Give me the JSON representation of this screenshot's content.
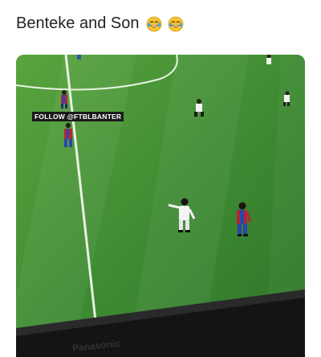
{
  "post": {
    "caption": "Benteke and Son",
    "emoji": [
      "face-with-tears-of-joy-icon",
      "face-with-tears-of-joy-icon"
    ]
  },
  "video": {
    "watermark": "FOLLOW @FTBLBANTER",
    "tv_brand": "Panasonic"
  },
  "colors": {
    "pitch_light": "#4e9a3a",
    "pitch_dark": "#2f7a2a",
    "line": "#e9f3e3",
    "emoji_yellow": "#f7c331",
    "tear_blue": "#4aa3df"
  }
}
